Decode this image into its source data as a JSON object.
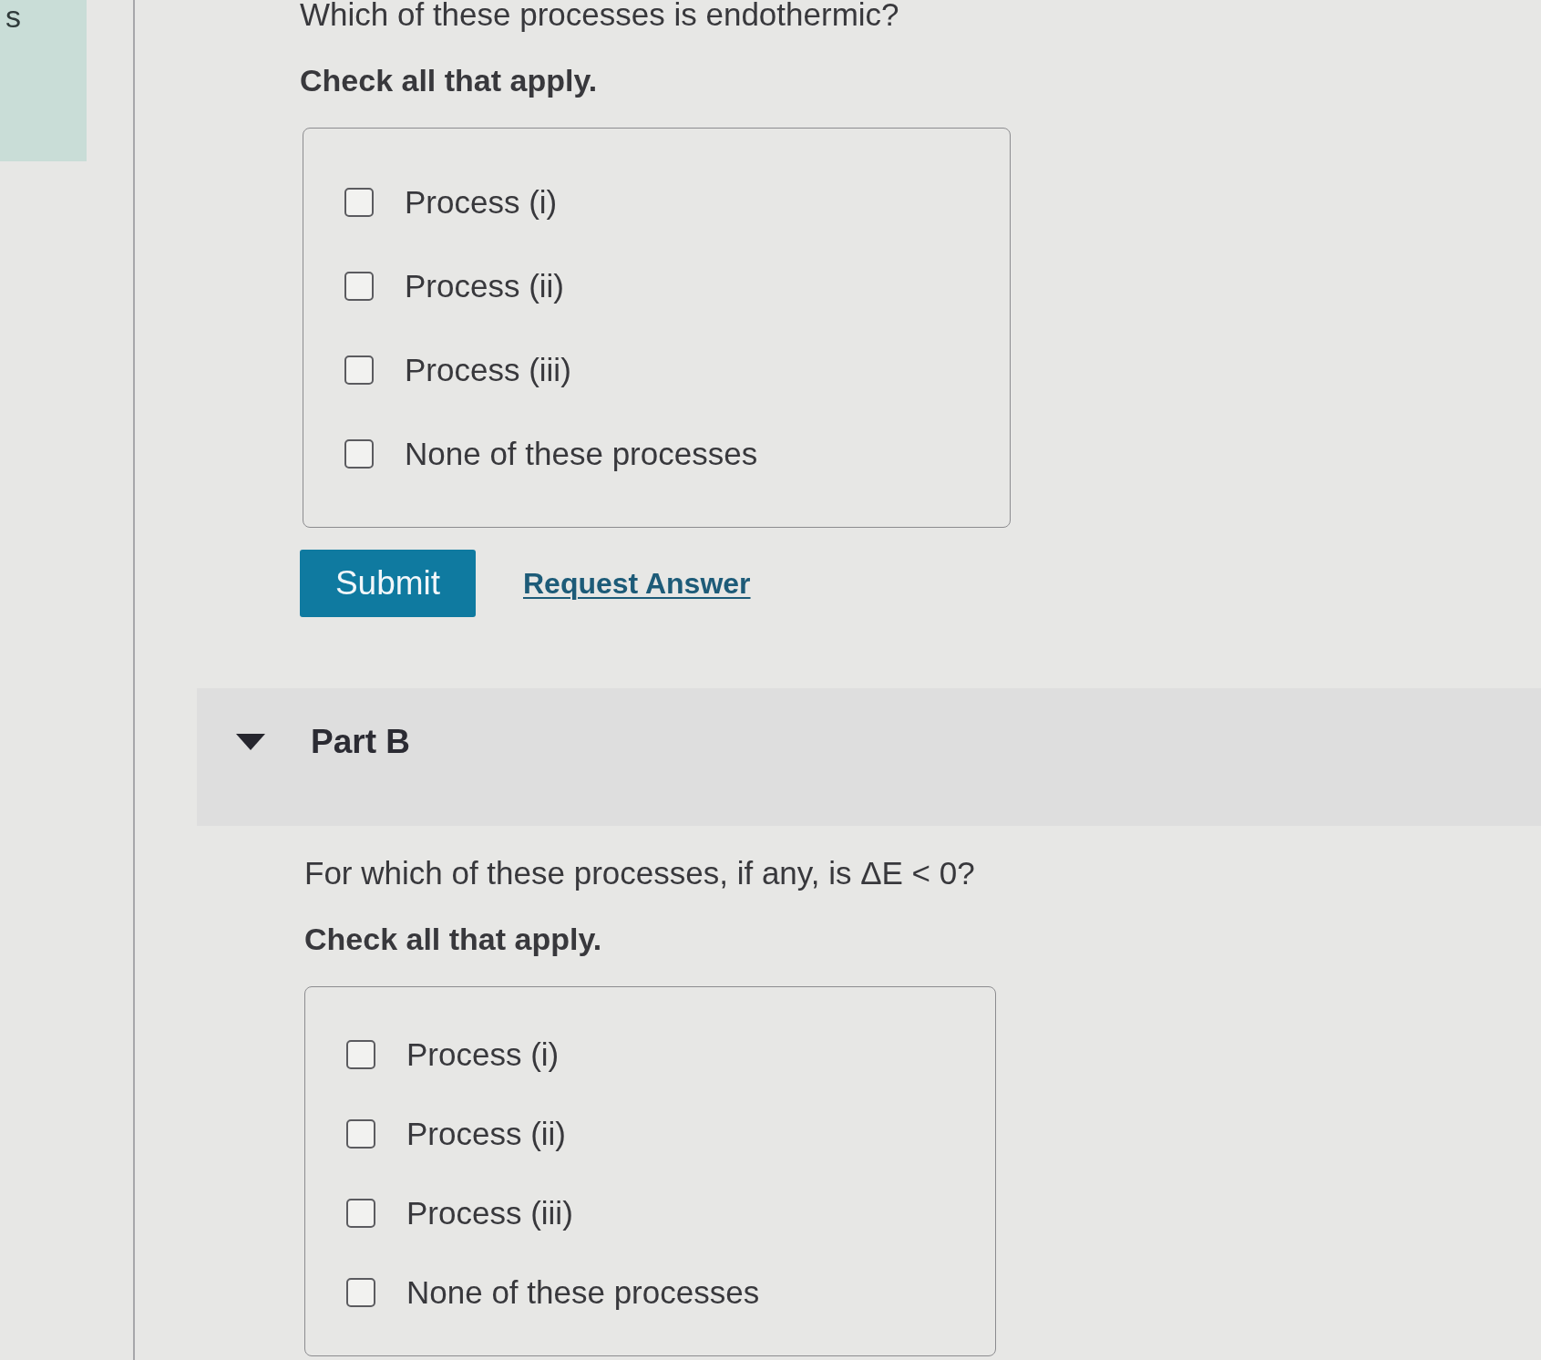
{
  "sidebar": {
    "label": "s"
  },
  "part_a": {
    "question": "Which of these processes is endothermic?",
    "instruction": "Check all that apply.",
    "options": [
      {
        "label": "Process (i)",
        "checked": false
      },
      {
        "label": "Process (ii)",
        "checked": false
      },
      {
        "label": "Process (iii)",
        "checked": false
      },
      {
        "label": "None of these processes",
        "checked": false
      }
    ],
    "submit": "Submit",
    "request_answer": "Request Answer"
  },
  "part_b": {
    "title": "Part B",
    "expanded": true,
    "question": "For which of these processes, if any, is ΔE < 0?",
    "instruction": "Check all that apply.",
    "options": [
      {
        "label": "Process (i)",
        "checked": false
      },
      {
        "label": "Process (ii)",
        "checked": false
      },
      {
        "label": "Process (iii)",
        "checked": false
      },
      {
        "label": "None of these processes",
        "checked": false
      }
    ]
  }
}
